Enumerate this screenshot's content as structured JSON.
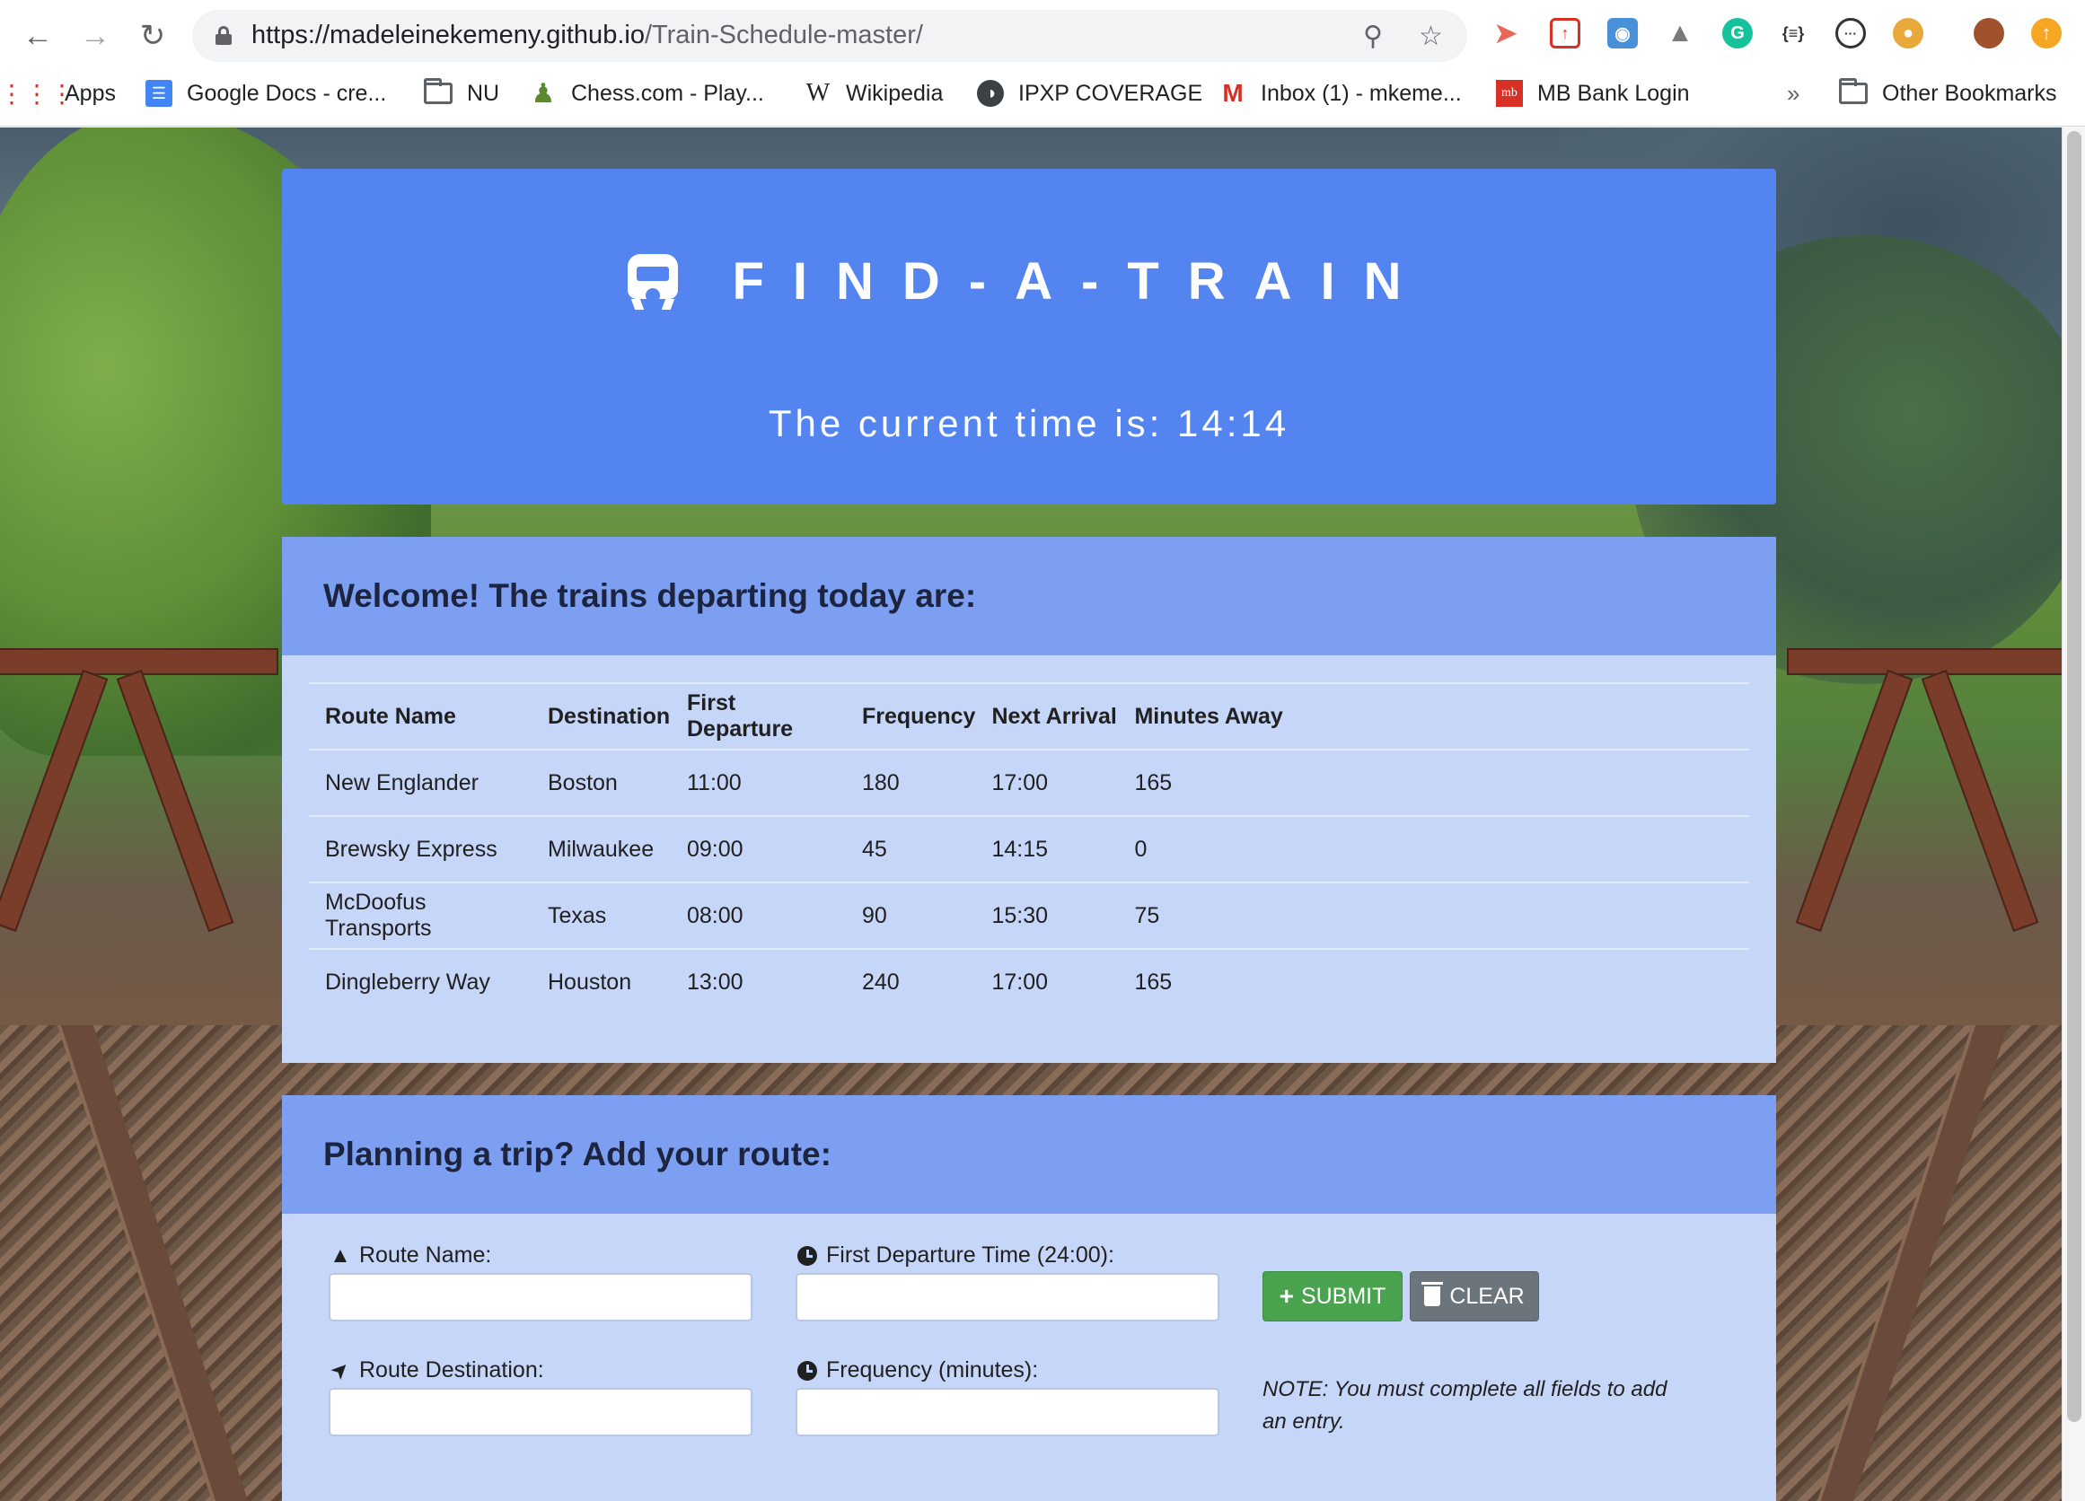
{
  "browser": {
    "url_domain": "https://madeleinekemeny.github.io",
    "url_path": "/Train-Schedule-master/",
    "bookmarks": [
      {
        "label": "Apps",
        "icon": "apps-grid-icon"
      },
      {
        "label": "Google Docs - cre...",
        "icon": "google-docs-icon"
      },
      {
        "label": "NU",
        "icon": "folder-icon"
      },
      {
        "label": "Chess.com - Play...",
        "icon": "chess-pawn-icon"
      },
      {
        "label": "Wikipedia",
        "icon": "wikipedia-icon"
      },
      {
        "label": "IPXP COVERAGE",
        "icon": "globe-icon"
      },
      {
        "label": "Inbox (1) - mkeme...",
        "icon": "gmail-icon"
      },
      {
        "label": "MB Bank Login",
        "icon": "mb-bank-icon"
      }
    ],
    "overflow_label": "»",
    "other_bookmarks": "Other Bookmarks"
  },
  "header": {
    "title": "FIND-A-TRAIN",
    "time_label": "The current time is: 14:14"
  },
  "trains_panel": {
    "heading": "Welcome! The trains departing today are:",
    "columns": [
      "Route Name",
      "Destination",
      "First Departure",
      "Frequency",
      "Next Arrival",
      "Minutes Away"
    ],
    "rows": [
      [
        "New Englander",
        "Boston",
        "11:00",
        "180",
        "17:00",
        "165"
      ],
      [
        "Brewsky Express",
        "Milwaukee",
        "09:00",
        "45",
        "14:15",
        "0"
      ],
      [
        "McDoofus Transports",
        "Texas",
        "08:00",
        "90",
        "15:30",
        "75"
      ],
      [
        "Dingleberry Way",
        "Houston",
        "13:00",
        "240",
        "17:00",
        "165"
      ]
    ]
  },
  "add_panel": {
    "heading": "Planning a trip? Add your route:",
    "route_name_label": "Route Name:",
    "destination_label": "Route Destination:",
    "first_departure_label": "First Departure Time (24:00):",
    "frequency_label": "Frequency (minutes):",
    "submit_label": "SUBMIT",
    "clear_label": "CLEAR",
    "note": "NOTE: You must complete all fields to add an entry."
  },
  "colors": {
    "jumbotron": "#5384f0",
    "panel_heading": "#7c9ff2",
    "panel_body": "#c6d6f8",
    "submit": "#4aa34e",
    "clear": "#6c747c"
  }
}
